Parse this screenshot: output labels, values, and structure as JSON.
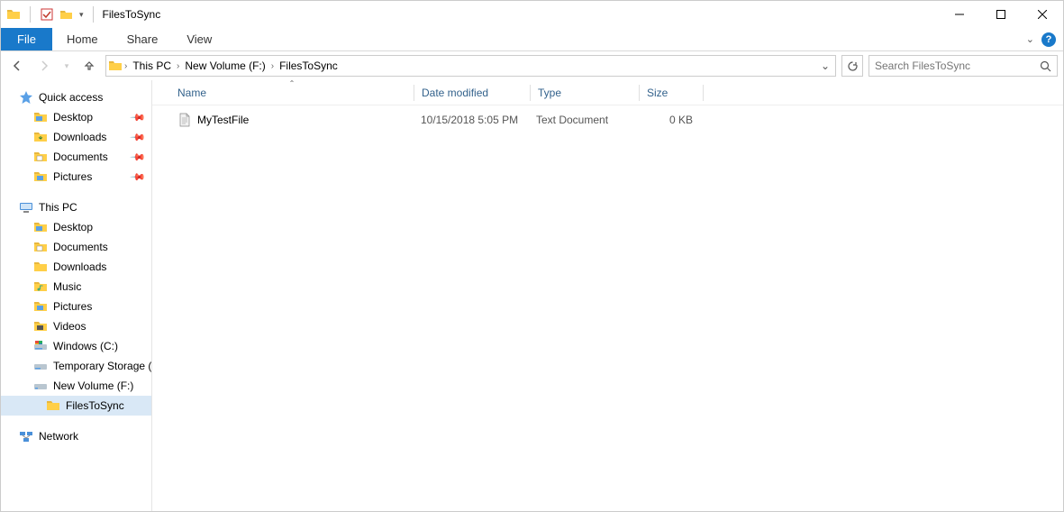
{
  "window": {
    "title": "FilesToSync"
  },
  "ribbon": {
    "file": "File",
    "tabs": [
      "Home",
      "Share",
      "View"
    ]
  },
  "breadcrumb": {
    "items": [
      "This PC",
      "New Volume (F:)",
      "FilesToSync"
    ]
  },
  "search": {
    "placeholder": "Search FilesToSync"
  },
  "nav": {
    "quick_access": {
      "label": "Quick access",
      "items": [
        "Desktop",
        "Downloads",
        "Documents",
        "Pictures"
      ]
    },
    "this_pc": {
      "label": "This PC",
      "items": [
        "Desktop",
        "Documents",
        "Downloads",
        "Music",
        "Pictures",
        "Videos",
        "Windows (C:)",
        "Temporary Storage (",
        "New Volume (F:)"
      ],
      "subfolder": "FilesToSync"
    },
    "network": {
      "label": "Network"
    }
  },
  "columns": {
    "name": "Name",
    "date": "Date modified",
    "type": "Type",
    "size": "Size"
  },
  "files": [
    {
      "name": "MyTestFile",
      "date": "10/15/2018 5:05 PM",
      "type": "Text Document",
      "size": "0 KB"
    }
  ]
}
